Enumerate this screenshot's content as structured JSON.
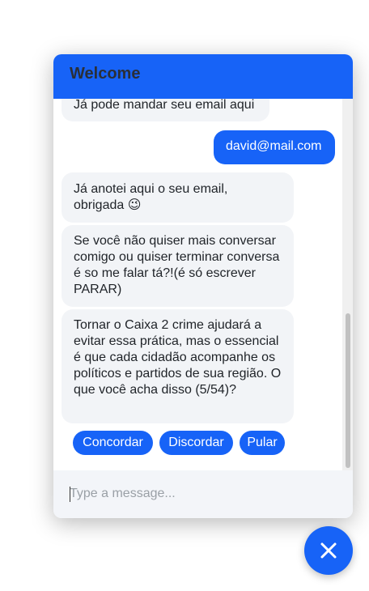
{
  "header": {
    "title": "Welcome"
  },
  "messages": [
    {
      "sender": "bot",
      "text": "Já pode mandar seu email aqui"
    },
    {
      "sender": "user",
      "text": "david@mail.com"
    },
    {
      "sender": "bot",
      "text": "Já anotei aqui o seu email, obrigada",
      "emoji": "😉"
    },
    {
      "sender": "bot",
      "text": "Se você não quiser mais conversar comigo ou quiser terminar conversa é so me falar tá?!(é só escrever PARAR)"
    },
    {
      "sender": "bot",
      "text": "Tornar o Caixa 2 crime ajudará a evitar essa prática, mas o essencial é que cada cidadão acompanhe os políticos e partidos de sua região. O que você acha disso (5/54)?"
    }
  ],
  "quick_replies": [
    "Concordar",
    "Discordar",
    "Pular"
  ],
  "composer": {
    "placeholder": "Type a message..."
  },
  "launcher": {
    "icon": "close-icon"
  },
  "colors": {
    "accent": "#1763f7",
    "bot_bubble": "#f2f4f7",
    "header_text": "#2a2f38"
  }
}
